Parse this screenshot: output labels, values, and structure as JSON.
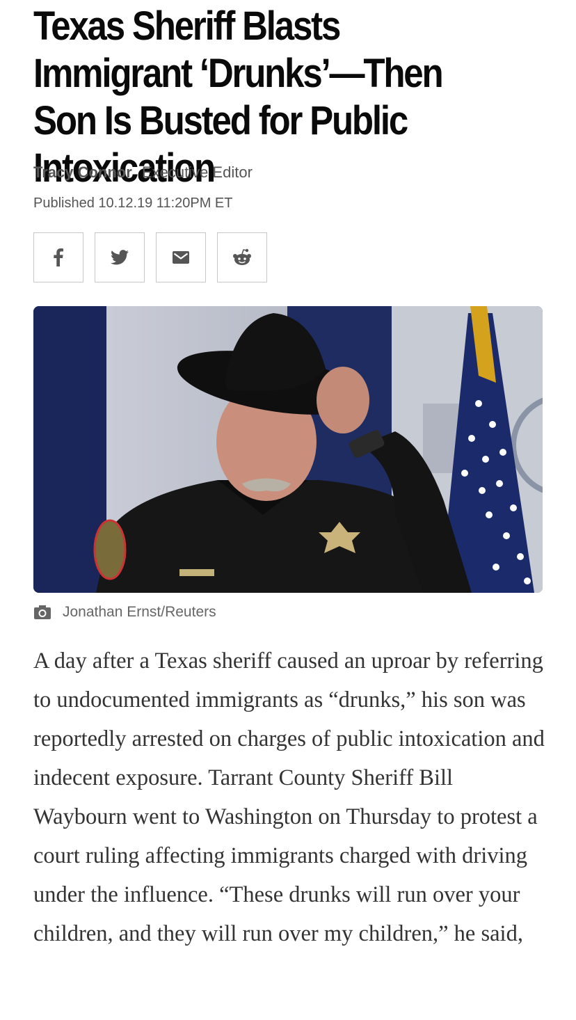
{
  "article": {
    "headline": "Texas Sheriff Blasts Immigrant ‘Drunks’—Then Son Is Busted for Public Intoxication",
    "author": "Tracy Connor",
    "author_role": "Executive Editor",
    "published": "Published 10.12.19 11:20PM ET",
    "photo_credit": "Jonathan Ernst/Reuters",
    "body": "A day after a Texas sheriff caused an uproar by referring to undocumented immigrants as “drunks,” his son was reportedly arrested on charges of public intoxication and indecent exposure. Tarrant County Sheriff Bill Waybourn went to Washington on Thursday to protest a court ruling affecting immigrants charged with driving under the influence. “These drunks will run over your children, and they will run over my children,” he said,"
  },
  "share_buttons": [
    {
      "icon": "facebook-icon"
    },
    {
      "icon": "twitter-icon"
    },
    {
      "icon": "email-icon"
    },
    {
      "icon": "reddit-icon"
    }
  ],
  "colors": {
    "headline": "#0a0a0a",
    "meta": "#555555",
    "body": "#333333",
    "share_border": "#c8c8c8",
    "icon": "#555555"
  }
}
